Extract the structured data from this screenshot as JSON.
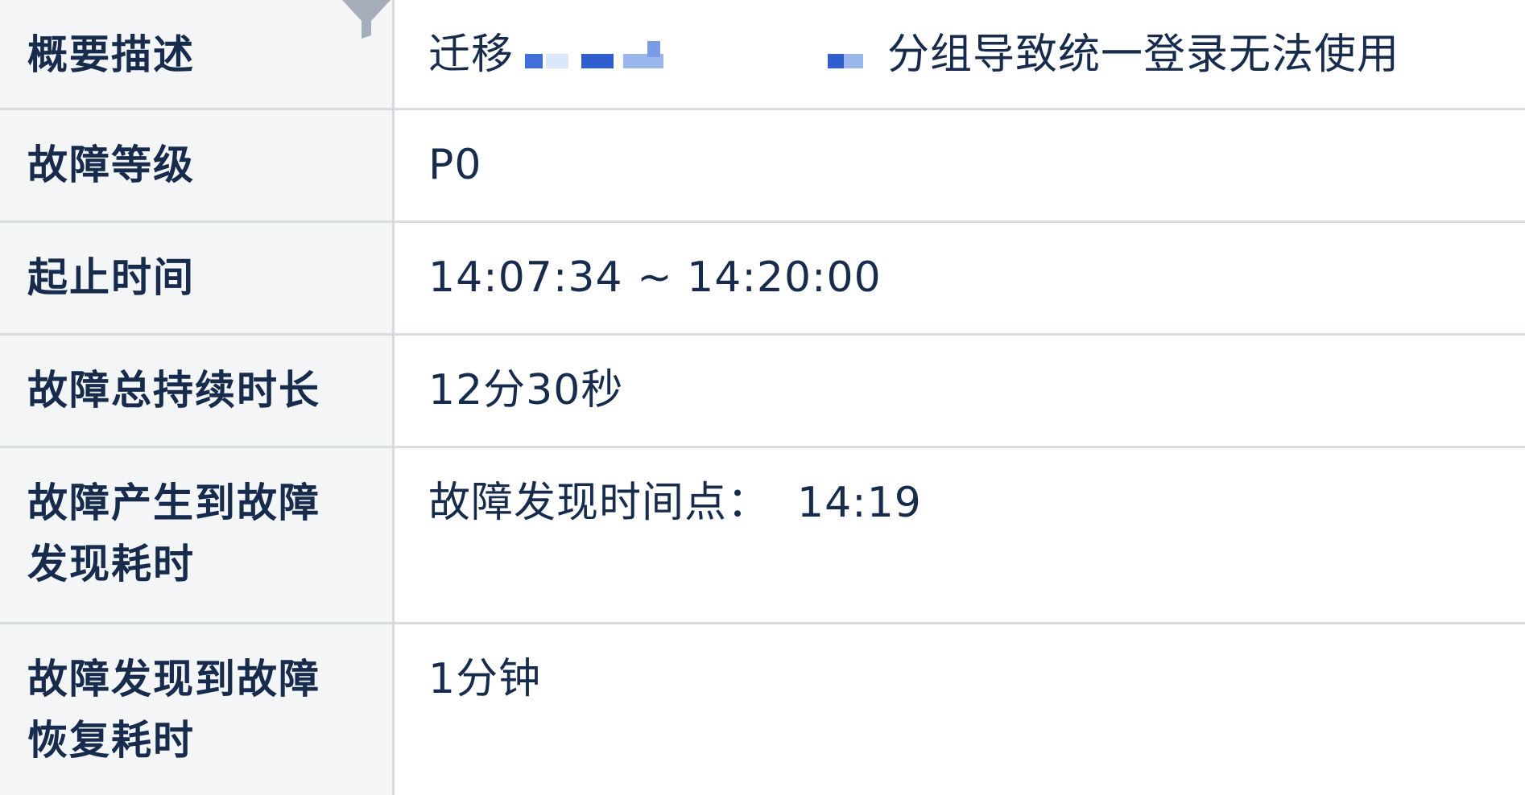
{
  "rows": [
    {
      "label": "概要描述",
      "value_prefix": "迁移",
      "value_suffix": "分组导致统一登录无法使用"
    },
    {
      "label": "故障等级",
      "value": "P0"
    },
    {
      "label": "起止时间",
      "value": "14:07:34 ~ 14:20:00"
    },
    {
      "label": "故障总持续时长",
      "value": "12分30秒"
    },
    {
      "label_line1": "故障产生到故障",
      "label_line2": "发现耗时",
      "value_label": "故障发现时间点：",
      "value_time": "14:19"
    },
    {
      "label_line1": "故障发现到故障",
      "label_line2": "恢复耗时",
      "value": "1分钟"
    }
  ],
  "icons": {
    "filter": "filter-icon"
  },
  "colors": {
    "label_bg": "#f4f5f7",
    "border": "#d7dbe0",
    "text": "#172b4d",
    "redaction_blue": "#3f6fd8"
  }
}
